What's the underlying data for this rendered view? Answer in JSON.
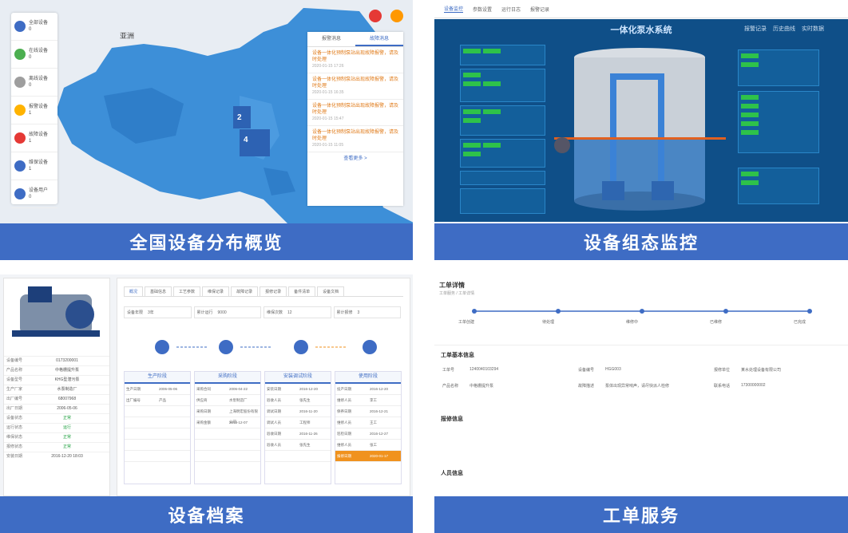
{
  "colors": {
    "caption_bg": "#3e6cc4",
    "map_fill": "#3d8fd8",
    "scada_bg": "#0f4f88",
    "status_ok": "#20a040",
    "highlight": "#f0921e"
  },
  "panels": [
    {
      "caption": "全国设备分布概览"
    },
    {
      "caption": "设备组态监控"
    },
    {
      "caption": "设备档案"
    },
    {
      "caption": "工单服务"
    }
  ],
  "map": {
    "region_label": "亚洲",
    "clusters": [
      {
        "count": "2"
      },
      {
        "count": "4"
      }
    ],
    "sidebar": [
      {
        "label": "全部设备",
        "count": "0",
        "icon": "grid-icon",
        "color": "#3e6cc4"
      },
      {
        "label": "在线设备",
        "count": "0",
        "icon": "online-icon",
        "color": "#4caf50"
      },
      {
        "label": "离线设备",
        "count": "0",
        "icon": "offline-icon",
        "color": "#9e9e9e"
      },
      {
        "label": "报警设备",
        "count": "1",
        "icon": "alarm-icon",
        "color": "#ffb300"
      },
      {
        "label": "故障设备",
        "count": "1",
        "icon": "fault-icon",
        "color": "#e53935"
      },
      {
        "label": "维保设备",
        "count": "1",
        "icon": "wrench-icon",
        "color": "#3e6cc4"
      },
      {
        "label": "设备用户",
        "count": "0",
        "icon": "user-icon",
        "color": "#3e6cc4"
      }
    ],
    "news_tabs": [
      "报警消息",
      "故障消息"
    ],
    "news": [
      {
        "text": "设备一体化预制泵站出现故障报警，请及时处理",
        "date": "2020-01-15 17:26"
      },
      {
        "text": "设备一体化预制泵站出现故障报警，请及时处理",
        "date": "2020-01-15 16:35"
      },
      {
        "text": "设备一体化预制泵站出现故障报警，请及时处理",
        "date": "2020-01-15 15:47"
      },
      {
        "text": "设备一体化预制泵站出现故障报警，请及时处理",
        "date": "2020-01-15 11:05"
      }
    ],
    "more": "查看更多 >"
  },
  "scada": {
    "nav": [
      "设备监控",
      "参数设置",
      "运行日志",
      "报警记录"
    ],
    "title": "一体化泵水系统",
    "toolbar": [
      "报警记录",
      "历史曲线",
      "实时数据"
    ]
  },
  "archive": {
    "info_rows": [
      {
        "k": "设备编号",
        "v": "0173200001"
      },
      {
        "k": "产品名称",
        "v": "中格栅提升泵"
      },
      {
        "k": "设备型号",
        "v": "KHG型潜污泵"
      },
      {
        "k": "生产厂家",
        "v": "水泵制造厂"
      },
      {
        "k": "出厂编号",
        "v": "68007968"
      },
      {
        "k": "出厂日期",
        "v": "2006-05-06"
      },
      {
        "k": "设备状态",
        "v": "正常",
        "ok": true
      },
      {
        "k": "运行状态",
        "v": "运行",
        "ok": true
      },
      {
        "k": "维保状态",
        "v": "正常",
        "ok": true
      },
      {
        "k": "报修状态",
        "v": "正常",
        "ok": true
      },
      {
        "k": "安装日期",
        "v": "2016-12-20 18:03"
      }
    ],
    "tabs": [
      "概况",
      "基础信息",
      "工艺参数",
      "维保记录",
      "故障记录",
      "报修记录",
      "备件清单",
      "设备文档"
    ],
    "stats": [
      {
        "k": "设备年限",
        "v": "3年"
      },
      {
        "k": "累计运行",
        "v": "9000"
      },
      {
        "k": "维保次数",
        "v": "12"
      },
      {
        "k": "累计报修",
        "v": "3"
      }
    ],
    "columns": [
      {
        "title": "生产阶段",
        "rows": [
          [
            "生产日期",
            "2006-05-06"
          ],
          [
            "出厂编号",
            "产品"
          ]
        ]
      },
      {
        "title": "采购阶段",
        "rows": [
          [
            "采购合同",
            "2006-04-22"
          ],
          [
            "供应商",
            "水泵制造厂"
          ],
          [
            "采购日期",
            "上海明宏股份有限公司"
          ],
          [
            "采购金额",
            "2018-12-07"
          ]
        ]
      },
      {
        "title": "安装调试阶段",
        "rows": [
          [
            "安装日期",
            "2016-12-20"
          ],
          [
            "验收人员",
            "张先生"
          ],
          [
            "调试日期",
            "2016-11-20"
          ],
          [
            "调试人员",
            "工程师"
          ],
          [
            "验收日期",
            "2016-11-26"
          ],
          [
            "验收人员",
            "张先生"
          ]
        ]
      },
      {
        "title": "使用阶段",
        "rows": [
          [
            "投产日期",
            "2016-12-20"
          ],
          [
            "维修人员",
            "李工"
          ],
          [
            "保养日期",
            "2016-12-21"
          ],
          [
            "维修人员",
            "王工"
          ],
          [
            "巡检日期",
            "2016-12-27"
          ],
          [
            "维修人员",
            "张工"
          ],
          [
            "报修日期",
            "2020-01-17"
          ]
        ]
      }
    ]
  },
  "workorder": {
    "title": "工单详情",
    "breadcrumb": "工单服务 / 工单详情",
    "steps": [
      "工单创建",
      "待处理",
      "维修中",
      "已维修",
      "已完成"
    ],
    "sections": [
      "工单基本信息",
      "报修信息",
      "人员信息"
    ],
    "fields": [
      {
        "k": "工单号",
        "v": "1240040103294"
      },
      {
        "k": "设备编号",
        "v": "HGG003"
      },
      {
        "k": "报修单位",
        "v": "某水处理设备有限公司"
      },
      {
        "k": "产品名称",
        "v": "中格栅提升泵"
      },
      {
        "k": "故障描述",
        "v": "泵体出现异常响声，请尽快派人检修"
      },
      {
        "k": "联系电话",
        "v": "17300000002"
      }
    ]
  }
}
